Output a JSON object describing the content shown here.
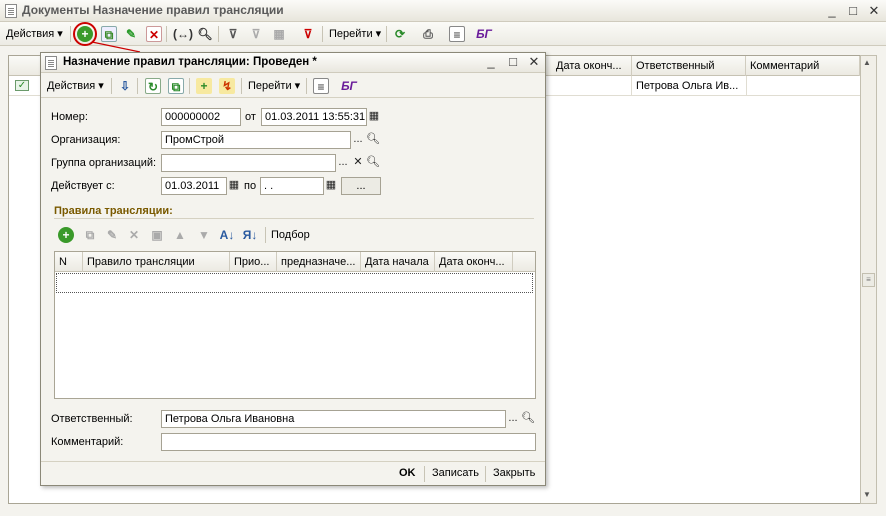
{
  "window": {
    "title": "Документы Назначение правил трансляции"
  },
  "toolbar": {
    "actions": "Действия",
    "goto": "Перейти"
  },
  "grid": {
    "columns": [
      "Дата оконч...",
      "Ответственный",
      "Комментарий"
    ],
    "row": {
      "responsible": "Петрова Ольга Ив..."
    }
  },
  "dialog": {
    "title": "Назначение правил трансляции: Проведен *",
    "toolbar": {
      "actions": "Действия",
      "goto": "Перейти"
    },
    "number_label": "Номер:",
    "number": "000000002",
    "from_label": "от",
    "datetime": "01.03.2011 13:55:31",
    "org_label": "Организация:",
    "org": "ПромСтрой",
    "group_label": "Группа организаций:",
    "group": "",
    "valid_label": "Действует с:",
    "valid_from": "01.03.2011",
    "to_label": "по",
    "valid_to": " .  .",
    "ellipsis": "...",
    "rules_section": "Правила трансляции:",
    "pick": "Подбор",
    "rules_columns": [
      "N",
      "Правило трансляции",
      "Прио...",
      "предназначе...",
      "Дата начала",
      "Дата оконч..."
    ],
    "responsible_label": "Ответственный:",
    "responsible": "Петрова Ольга Ивановна",
    "comment_label": "Комментарий:",
    "comment": "",
    "ok": "OK",
    "save": "Записать",
    "close": "Закрыть"
  },
  "colors": {
    "accent_red": "#cc0000",
    "green": "#3a9a2a",
    "brand_purple": "#6a1b9a"
  }
}
